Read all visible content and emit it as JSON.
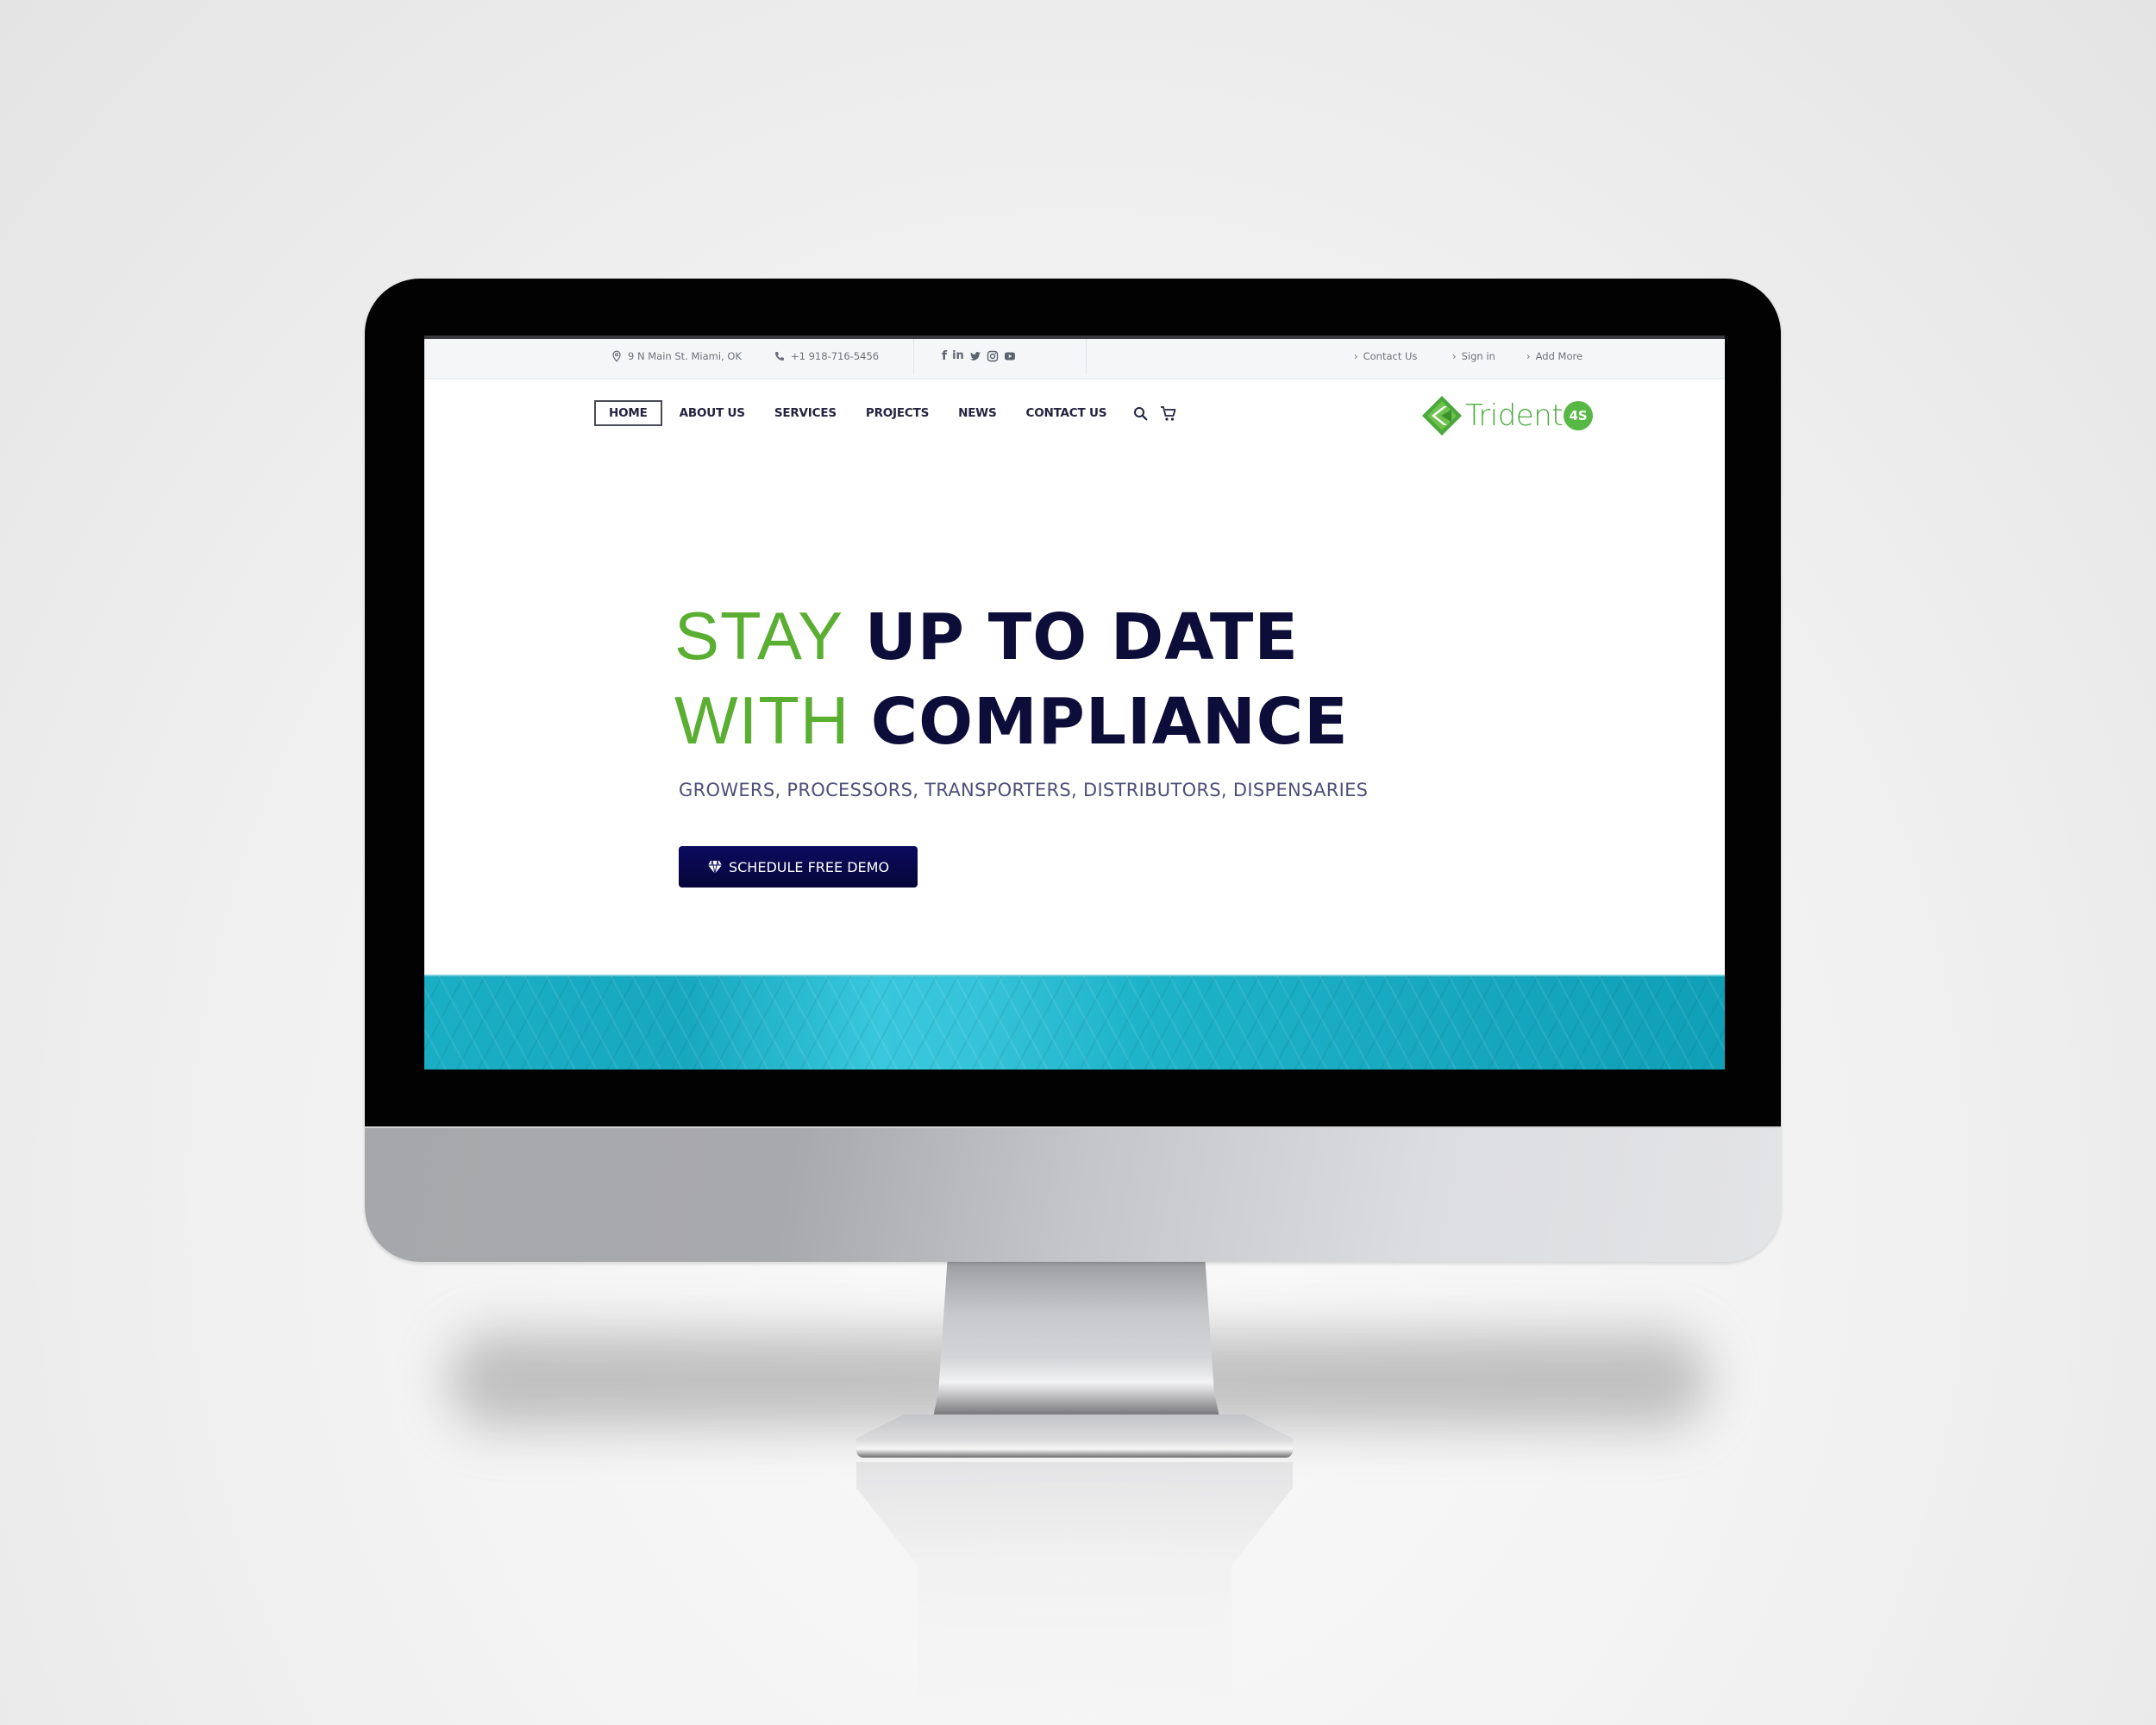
{
  "topbar": {
    "address": "9 N Main St. Miami, OK",
    "phone": "+1 918-716-5456",
    "social_icons": [
      "facebook-icon",
      "linkedin-icon",
      "twitter-icon",
      "instagram-icon",
      "youtube-icon"
    ],
    "links": [
      "Contact Us",
      "Sign in",
      "Add More"
    ]
  },
  "nav": {
    "items": [
      {
        "label": "HOME",
        "active": true
      },
      {
        "label": "ABOUT US",
        "active": false
      },
      {
        "label": "SERVICES",
        "active": false
      },
      {
        "label": "PROJECTS",
        "active": false
      },
      {
        "label": "NEWS",
        "active": false
      },
      {
        "label": "CONTACT US",
        "active": false
      }
    ],
    "icons": [
      "search-icon",
      "cart-icon"
    ]
  },
  "logo": {
    "text": "Trident",
    "badge": "4S"
  },
  "hero": {
    "line1_light": "STAY",
    "line1_bold": "UP TO DATE",
    "line2_light": "WITH",
    "line2_bold": "COMPLIANCE",
    "subtitle": "GROWERS, PROCESSORS, TRANSPORTERS, DISTRIBUTORS, DISPENSARIES",
    "cta_label": "SCHEDULE FREE DEMO",
    "cta_icon": "diamond-icon"
  },
  "colors": {
    "accent_green": "#5aae32",
    "brand_navy": "#0d0d3a",
    "button_navy": "#0b0a5e",
    "band_teal": "#1aaec4"
  }
}
